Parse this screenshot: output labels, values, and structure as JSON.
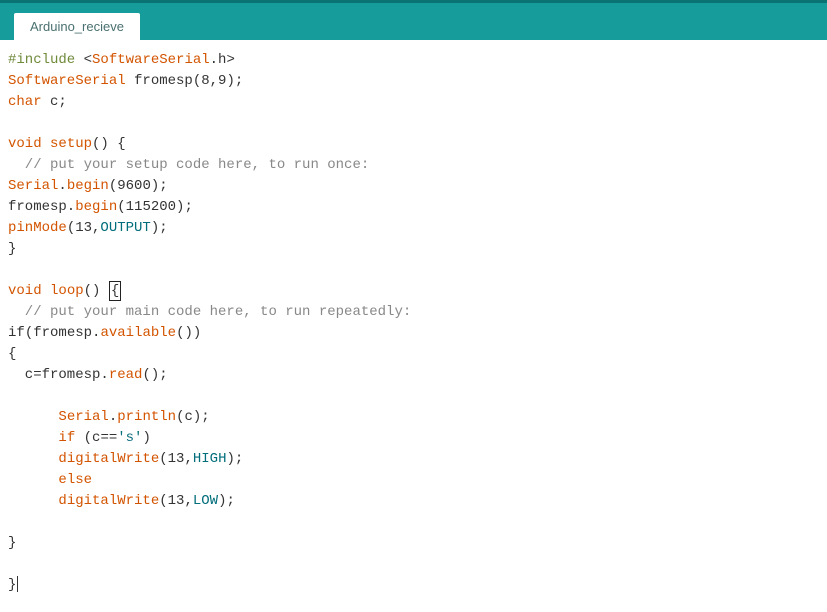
{
  "tab": {
    "label": "Arduino_recieve"
  },
  "code": {
    "t_include": "#include",
    "t_lt": " <",
    "t_softserial": "SoftwareSerial",
    "t_doth": ".h",
    "t_gt": ">",
    "t_fromesp_decl": " fromesp(8,9);",
    "t_char": "char",
    "t_c_decl": " c;",
    "t_void": "void",
    "t_setup": "setup",
    "t_parens_brace": "() {",
    "t_setup_comment": "  // put your setup code here, to run once:",
    "t_serial": "Serial",
    "t_dot": ".",
    "t_begin": "begin",
    "t_begin9600": "(9600);",
    "t_fromesp_obj": "fromesp.",
    "t_begin115200": "(115200);",
    "t_pinmode": "pinMode",
    "t_13comma": "(13,",
    "t_output": "OUTPUT",
    "t_closeparen_semi": ");",
    "t_closebrace": "}",
    "t_loop": "loop",
    "t_openparen_close": "() ",
    "t_openbrace": "{",
    "t_loop_comment": "  // put your main code here, to run repeatedly:",
    "t_if": "if",
    "t_open_fromesp": "(fromesp.",
    "t_available": "available",
    "t_close_paren2": "())",
    "t_c_assign": "  c=fromesp.",
    "t_read": "read",
    "t_parens_semi": "();",
    "t_indent6": "      ",
    "t_println": "println",
    "t_c_paren": "(c);",
    "t_if_kw": "if",
    "t_c_eq": " (c==",
    "t_s_str": "'s'",
    "t_closeparen": ")",
    "t_digitalwrite": "digitalWrite",
    "t_high": "HIGH",
    "t_else": "else",
    "t_low": "LOW"
  }
}
